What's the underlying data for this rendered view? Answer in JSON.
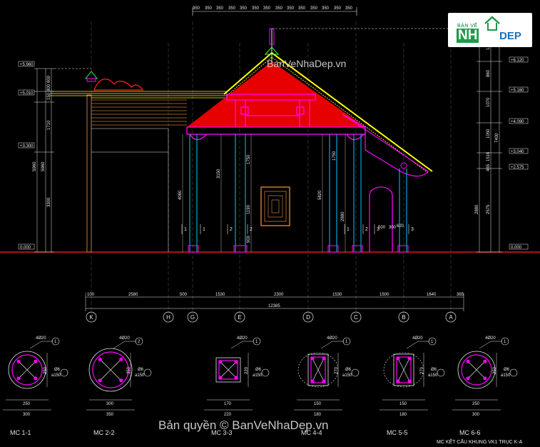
{
  "logo": {
    "small_text": "BẢN VẼ",
    "brand_nh": "NH",
    "brand_dep": "DEP"
  },
  "watermark_top": "BanVeNhaDep.vn",
  "watermark_bottom": "Bản quyền © BanVeNhaDep.vn",
  "elevation_tags": {
    "left": [
      "+5.960",
      "+5.010",
      "+3.300",
      "0.000"
    ],
    "right": [
      "+7.400",
      "+6.120",
      "+5.160",
      "+4.090",
      "+3.040",
      "+2.575",
      "0.000"
    ]
  },
  "top_dims": [
    "350",
    "350",
    "350",
    "350",
    "350",
    "350",
    "350",
    "350",
    "350",
    "350",
    "350",
    "350",
    "350",
    "350"
  ],
  "right_dims": [
    "12",
    "860",
    "1070",
    "1050",
    "1516",
    "465",
    "2575",
    "7400",
    "2880"
  ],
  "left_dims": [
    "800",
    "150",
    "800",
    "1710",
    "3300",
    "5960",
    "5960"
  ],
  "interior_dims": [
    "4060",
    "3150",
    "1750",
    "1190",
    "900",
    "5820",
    "2880",
    "1750",
    "500",
    "300",
    "620"
  ],
  "bottom_dims": {
    "row1": [
      "100",
      "2580",
      "500",
      "1530",
      "2300",
      "1530",
      "1500",
      "1640",
      "365"
    ],
    "total": "12385"
  },
  "grid_axes": [
    "K",
    "H",
    "G",
    "E",
    "D",
    "C",
    "B",
    "A"
  ],
  "column_marks": [
    "1",
    "1",
    "2",
    "2",
    "1",
    "2",
    "3",
    "3"
  ],
  "sections": [
    {
      "name": "MC 1-1",
      "label_top": "4Ø20",
      "callout": "1",
      "stirrup": "Ø6",
      "spacing": "a150",
      "dim_w": "250",
      "dim_total": "300",
      "dim_h": "250"
    },
    {
      "name": "MC 2-2",
      "label_top": "4Ø20",
      "callout": "2",
      "stirrup": "Ø6",
      "spacing": "a150",
      "dim_w": "300",
      "dim_total": "350",
      "dim_h": "350"
    },
    {
      "name": "MC 3-3",
      "label_top": "4Ø20",
      "callout": "1",
      "stirrup": "Ø6",
      "spacing": "a150",
      "dim_w": "170",
      "dim_total": "220",
      "dim_h": "220"
    },
    {
      "name": "MC 4-4",
      "label_top": "4Ø20",
      "callout": "1",
      "stirrup": "Ø6",
      "spacing": "a150",
      "dim_w": "150",
      "dim_total": "180",
      "dim_h": "270"
    },
    {
      "name": "MC 5-5",
      "label_top": "4Ø20",
      "callout": "1",
      "stirrup": "Ø6",
      "spacing": "a150",
      "dim_w": "150",
      "dim_total": "180",
      "dim_h": "270"
    },
    {
      "name": "MC 6-6",
      "label_top": "4Ø20",
      "callout": "1",
      "stirrup": "Ø6",
      "spacing": "a150",
      "dim_w": "250",
      "dim_total": "300",
      "dim_h": "250"
    }
  ],
  "drawing_title": "MC KẾT CẤU KHUNG VK1 TRỤC K-A",
  "colors": {
    "roof_red": "#ff0000",
    "roof_yellow": "#ffff00",
    "frame_magenta": "#ff00ff",
    "column_cyan": "#00c8ff",
    "dim_white": "#e8e8e8",
    "brown_wall": "#c87832",
    "ground_red": "#ff2020"
  }
}
